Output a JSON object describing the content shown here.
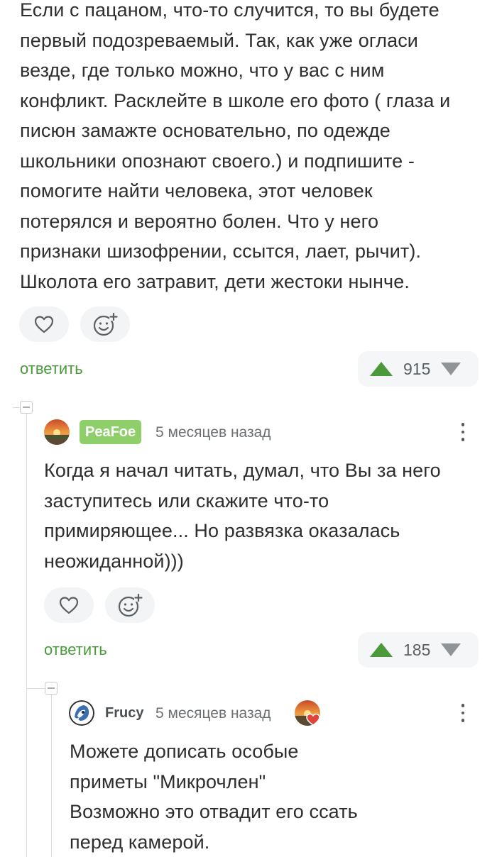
{
  "comment_main": {
    "lines": [
      "Если с пацаном, что-то случится, то вы будете",
      "первый подозреваемый. Так, как уже огласи",
      "везде, где только можно, что у вас с ним",
      "конфликт. Расклейте в школе его фото ( глаза и",
      "писюн замажте основательно, по одежде",
      "школьники опознают своего.) и подпишите -",
      "помогите найти человека, этот человек",
      "потерялся и вероятно болен. Что у него",
      "признаки шизофрении, ссытся, лает, рычит).",
      "Школота его затравит, дети жестоки нынче."
    ],
    "reply_label": "ответить",
    "rating": "915"
  },
  "comment_peafoe": {
    "username": "PeaFoe",
    "time": "5 месяцев назад",
    "lines": [
      "Когда я начал читать, думал, что Вы за него",
      "заступитесь или скажите что-то",
      "примиряющее... Но развязка оказалась",
      "неожиданной)))"
    ],
    "reply_label": "ответить",
    "rating": "185"
  },
  "comment_frucy": {
    "username": "Frucy",
    "time": "5 месяцев назад",
    "lines": [
      "Можете дописать особые",
      "приметы \"Микрочлен\"",
      "Возможно это отвадит его ссать",
      "перед камерой."
    ]
  },
  "colors": {
    "accent_green": "#4a9a3c",
    "badge_green": "#8fcf6a",
    "pill_bg": "#f2f4f5"
  }
}
